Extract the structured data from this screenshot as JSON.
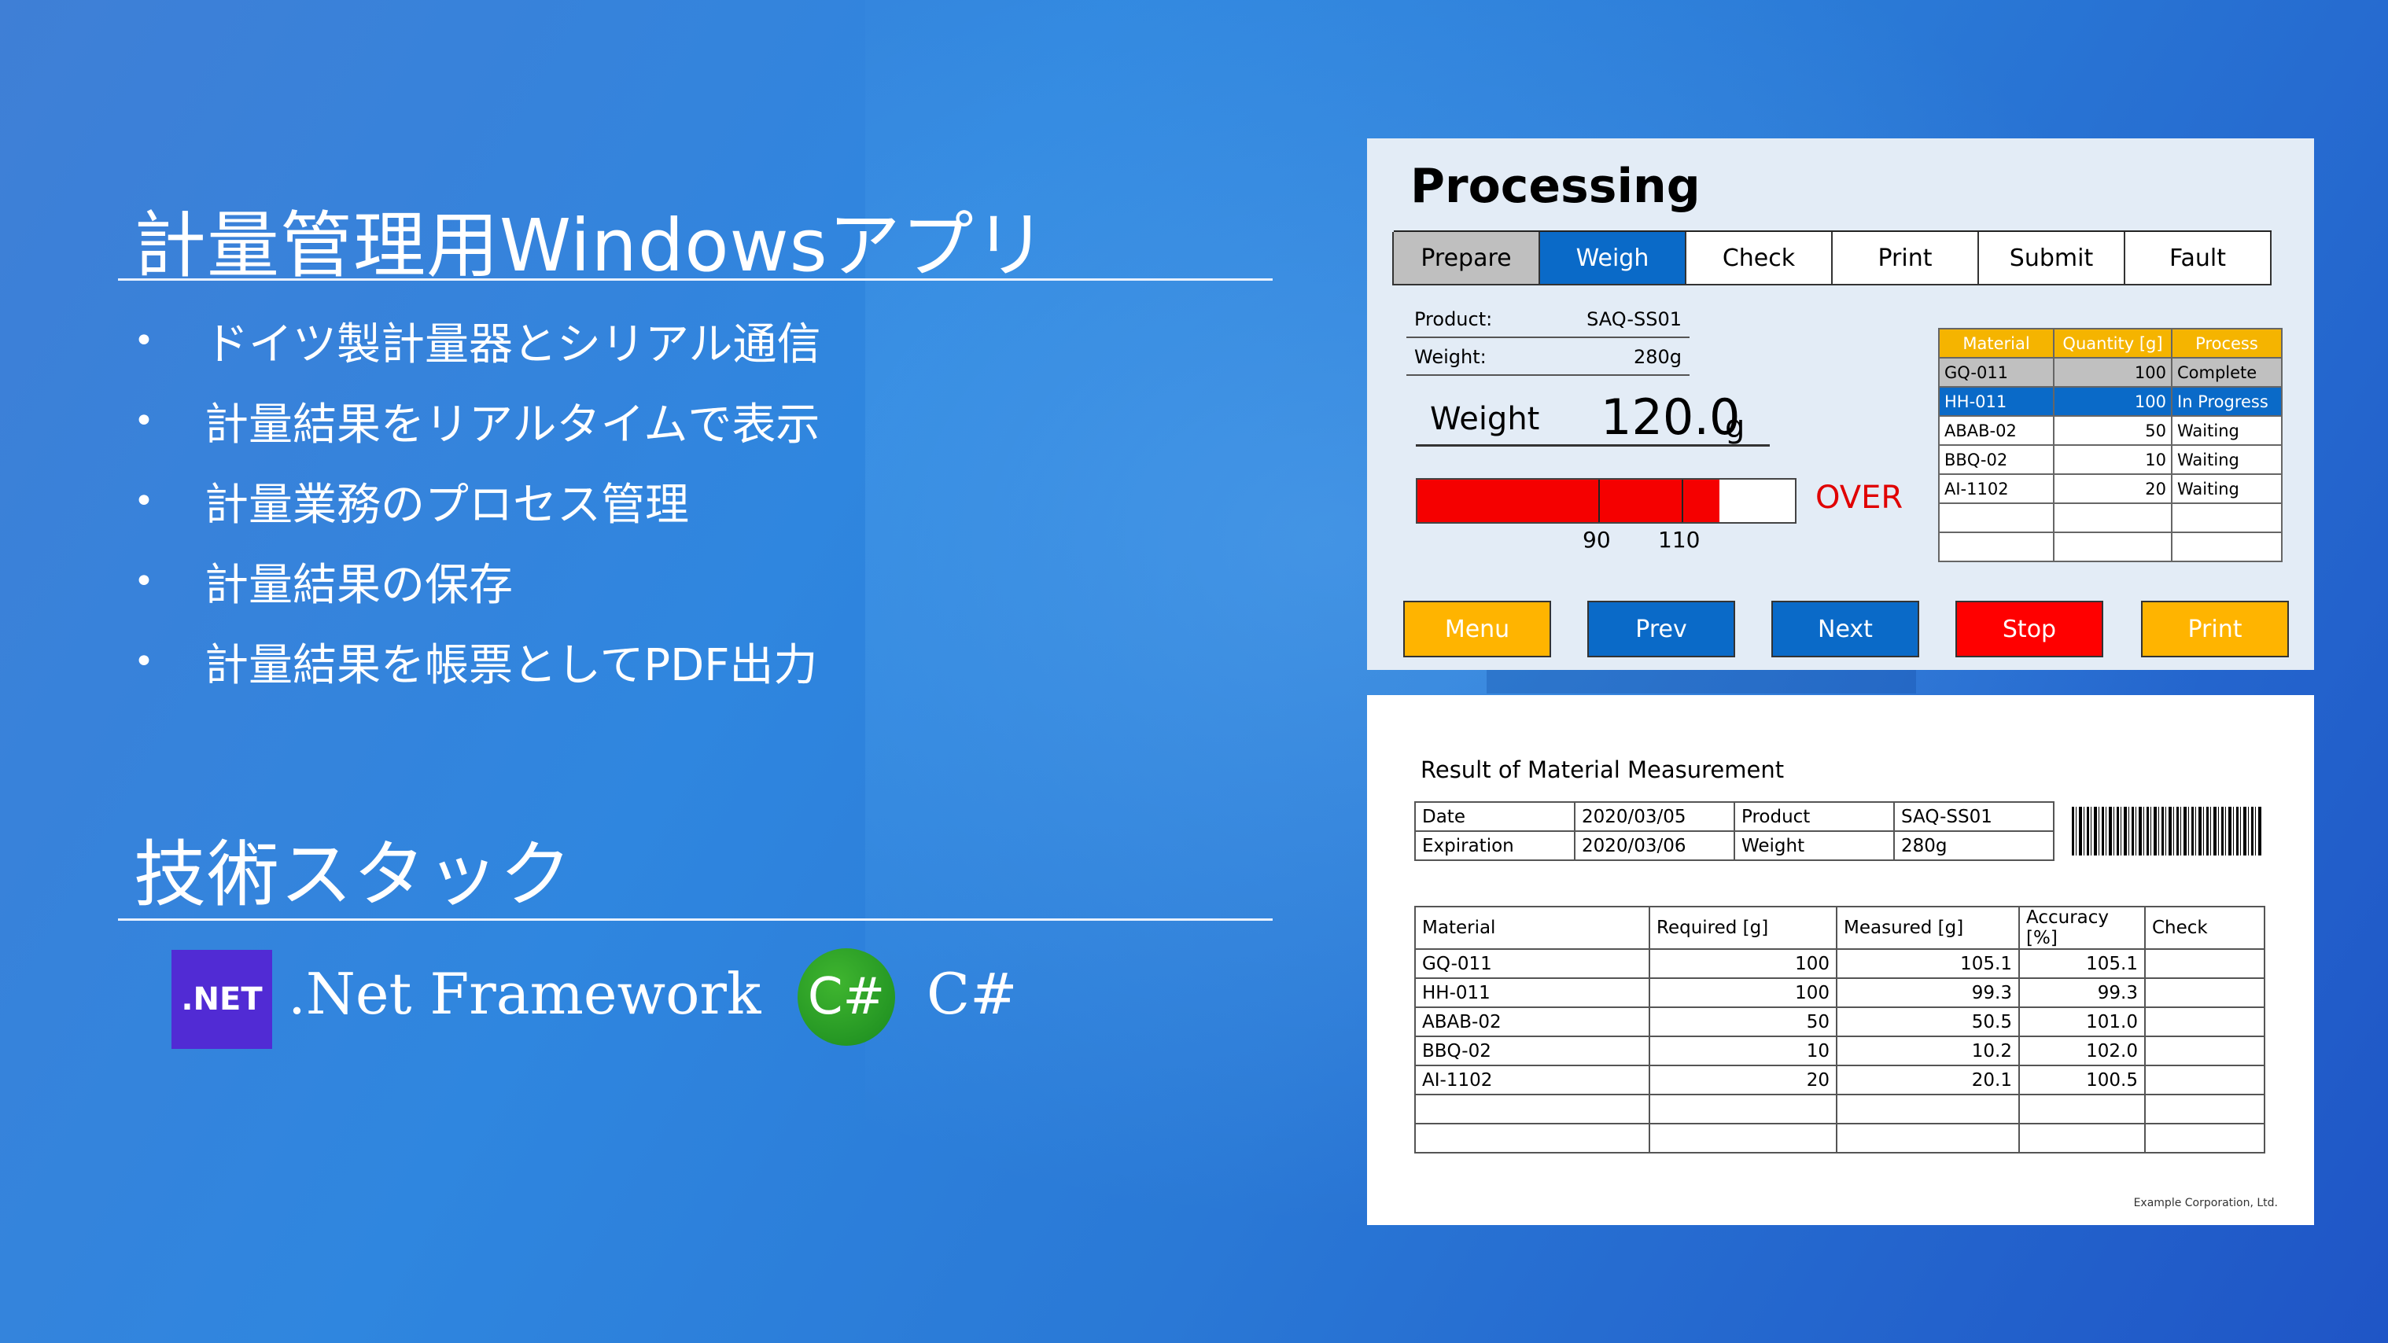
{
  "slide": {
    "title": "計量管理用Windowsアプリ",
    "features": [
      "ドイツ製計量器とシリアル通信",
      "計量結果をリアルタイムで表示",
      "計量業務のプロセス管理",
      "計量結果の保存",
      "計量結果を帳票としてPDF出力"
    ],
    "bullet_char": "•",
    "stack_title": "技術スタック",
    "dotnet_logo": ".NET",
    "dotnet_label": ".Net Framework",
    "csharp_logo": "C#",
    "csharp_label": "C#"
  },
  "app": {
    "title": "Processing",
    "tabs": [
      "Prepare",
      "Weigh",
      "Check",
      "Print",
      "Submit",
      "Fault"
    ],
    "active_tab": "Weigh",
    "product_label": "Product:",
    "product_value": "SAQ-SS01",
    "weight_label": "Weight:",
    "weight_value": "280g",
    "current_weight_label": "Weight",
    "current_weight_value": "120.0",
    "current_weight_unit": "g",
    "gauge": {
      "fill_percent": 80,
      "min_mark": "90",
      "max_mark": "110",
      "status": "OVER"
    },
    "process_table": {
      "headers": [
        "Material",
        "Quantity [g]",
        "Process"
      ],
      "rows": [
        [
          "GQ-011",
          "100",
          "Complete"
        ],
        [
          "HH-011",
          "100",
          "In Progress"
        ],
        [
          "ABAB-02",
          "50",
          "Waiting"
        ],
        [
          "BBQ-02",
          "10",
          "Waiting"
        ],
        [
          "AI-1102",
          "20",
          "Waiting"
        ],
        [
          "",
          "",
          ""
        ],
        [
          "",
          "",
          ""
        ]
      ]
    },
    "buttons": [
      "Menu",
      "Prev",
      "Next",
      "Stop",
      "Print"
    ],
    "colors": {
      "accent_blue": "#0a6ac8",
      "orange": "#ffb400",
      "red": "#ff0000"
    }
  },
  "report": {
    "title": "Result of Material Measurement",
    "header": [
      [
        "Date",
        "2020/03/05",
        "Product",
        "SAQ-SS01"
      ],
      [
        "Expiration",
        "2020/03/06",
        "Weight",
        "280g"
      ]
    ],
    "table": {
      "headers": [
        "Material",
        "Required [g]",
        "Measured [g]",
        "Accuracy [%]",
        "Check"
      ],
      "rows": [
        [
          "GQ-011",
          "100",
          "105.1",
          "105.1",
          ""
        ],
        [
          "HH-011",
          "100",
          "99.3",
          "99.3",
          ""
        ],
        [
          "ABAB-02",
          "50",
          "50.5",
          "101.0",
          ""
        ],
        [
          "BBQ-02",
          "10",
          "10.2",
          "102.0",
          ""
        ],
        [
          "AI-1102",
          "20",
          "20.1",
          "100.5",
          ""
        ],
        [
          "",
          "",
          "",
          "",
          ""
        ],
        [
          "",
          "",
          "",
          "",
          ""
        ]
      ]
    },
    "footer": "Example Corporation, Ltd."
  }
}
